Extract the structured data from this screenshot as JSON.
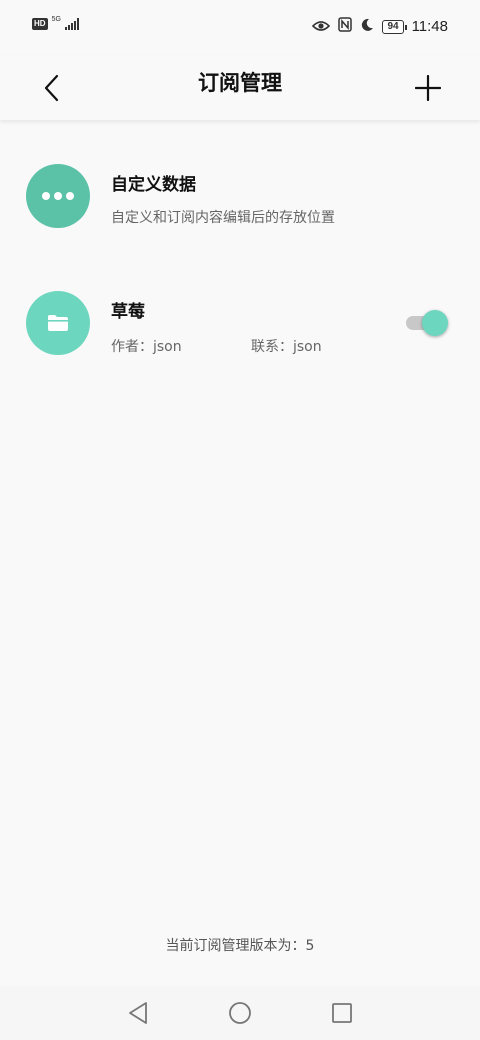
{
  "status_bar": {
    "hd_badge": "HD",
    "network": "5G",
    "battery": "94",
    "time": "11:48",
    "icons": [
      "eye-icon",
      "nfc-icon",
      "moon-icon"
    ]
  },
  "header": {
    "title": "订阅管理",
    "back_icon": "back-arrow-icon",
    "add_icon": "plus-icon"
  },
  "items": [
    {
      "title": "自定义数据",
      "subtitle": "自定义和订阅内容编辑后的存放位置",
      "icon": "more-dots-icon",
      "color": "#5bc2a8"
    },
    {
      "title": "草莓",
      "author": "作者：json",
      "contact": "联系：json",
      "icon": "folder-icon",
      "color": "#6dd6be",
      "enabled": true
    }
  ],
  "footer": {
    "version_text": "当前订阅管理版本为：5"
  },
  "nav": {
    "back_icon": "nav-back-icon",
    "home_icon": "nav-home-icon",
    "recents_icon": "nav-recents-icon"
  }
}
